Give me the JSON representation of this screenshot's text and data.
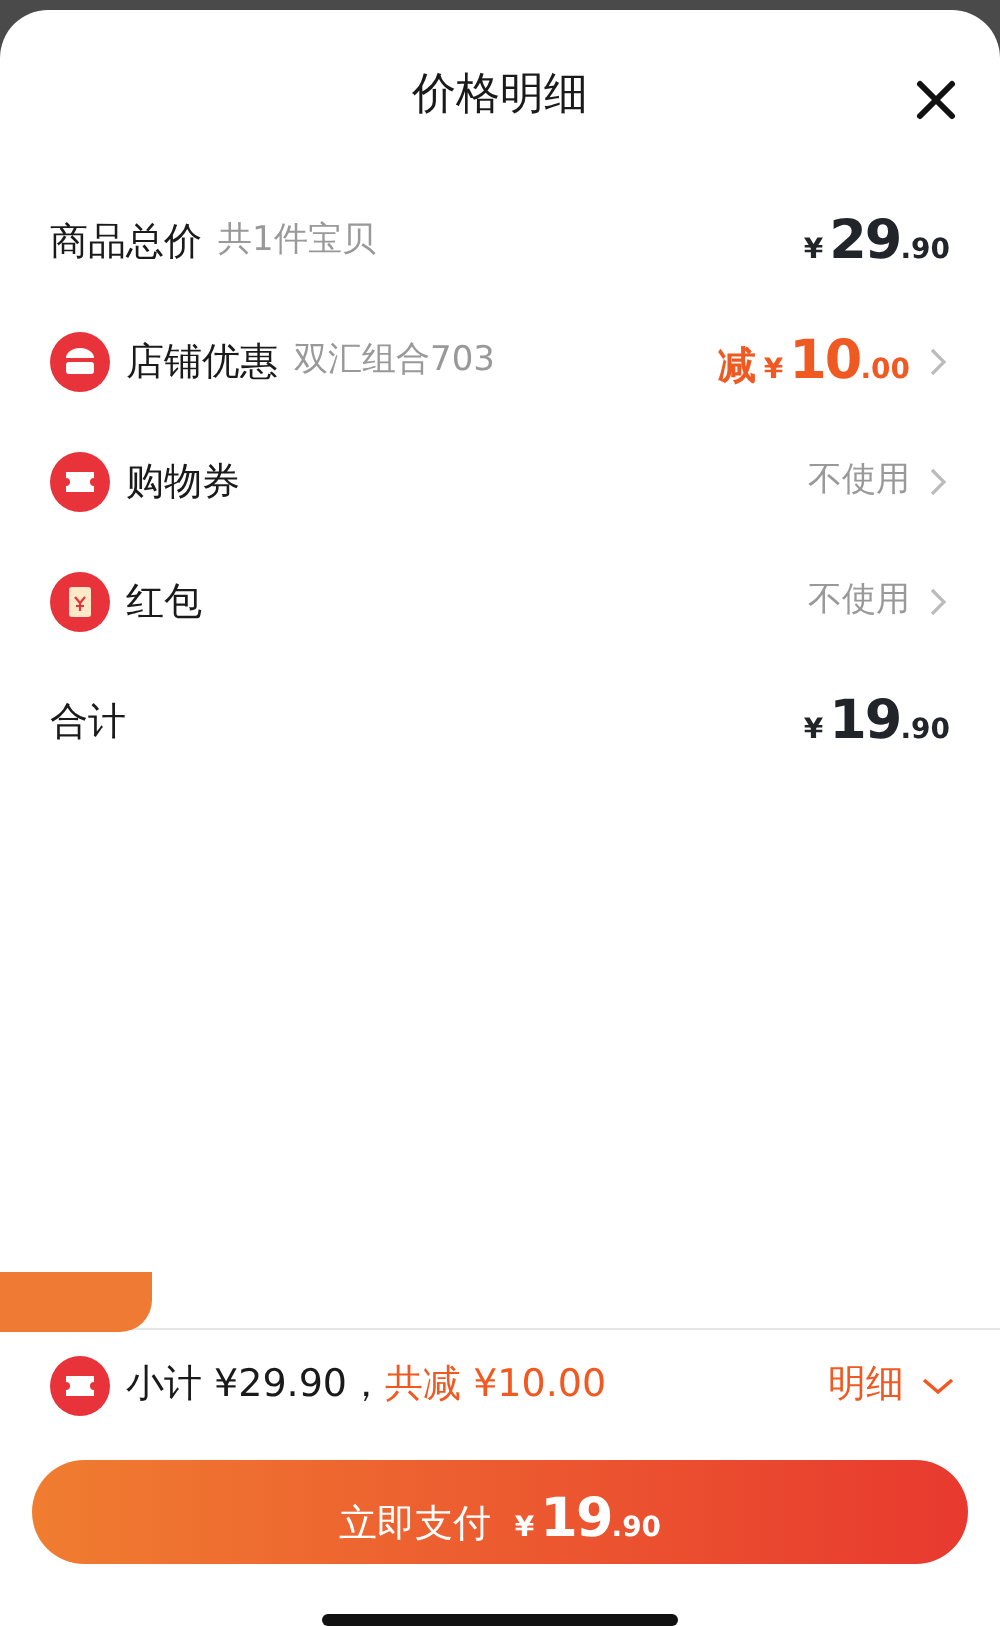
{
  "title": "价格明细",
  "rows": [
    {
      "kind": "goods_total",
      "label": "商品总价",
      "note": "共1件宝贝",
      "price": {
        "currency": "¥",
        "integer": "29",
        "decimal": ".90"
      }
    },
    {
      "kind": "store_discount",
      "label": "店铺优惠",
      "note": "双汇组合703",
      "prefix": "减",
      "price": {
        "currency": "¥",
        "integer": "10",
        "decimal": ".00"
      }
    },
    {
      "kind": "coupon",
      "label": "购物券",
      "value": "不使用"
    },
    {
      "kind": "red_packet",
      "label": "红包",
      "value": "不使用"
    },
    {
      "kind": "sum",
      "label": "合计",
      "price": {
        "currency": "¥",
        "integer": "19",
        "decimal": ".90"
      }
    }
  ],
  "summary": {
    "subtotal": "小计 ¥29.90，",
    "discount": "共减 ¥10.00",
    "details": "明细",
    "expanded": false
  },
  "pay_button": {
    "label": "立即支付",
    "currency": "¥",
    "integer": "19",
    "decimal": ".90"
  }
}
